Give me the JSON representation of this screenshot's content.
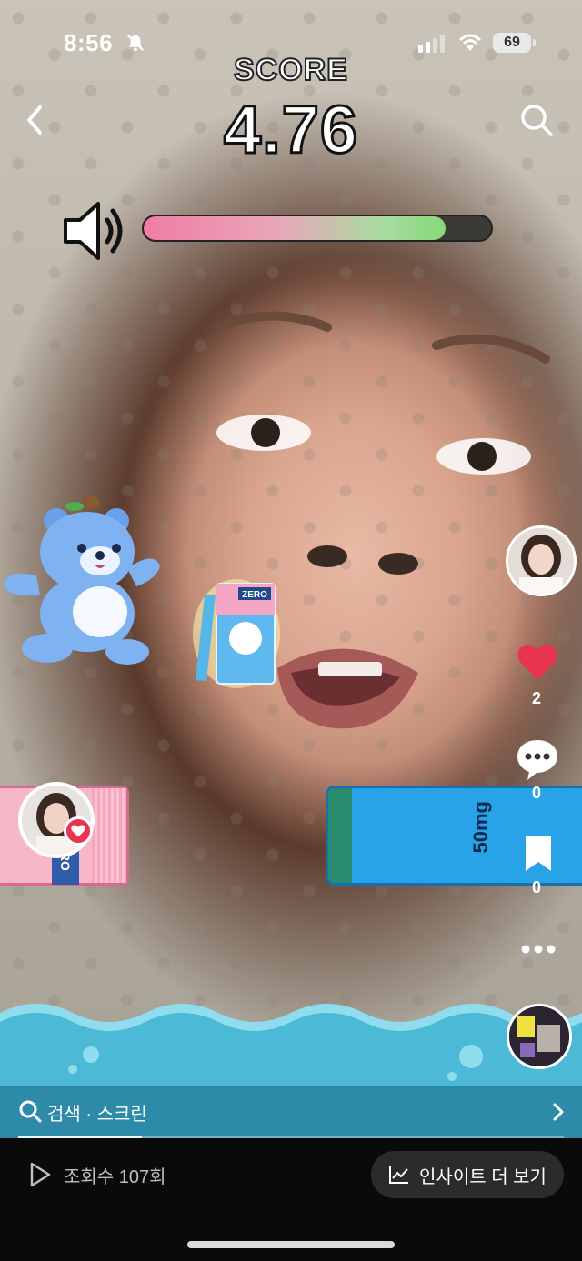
{
  "status_bar": {
    "time": "8:56",
    "battery": "69"
  },
  "game": {
    "score_label": "SCORE",
    "score_value": "4.76",
    "volume_level": 0.87
  },
  "packs": {
    "left_label": "ZERO",
    "right_label": "50mg"
  },
  "side_rail": {
    "like_count": "2",
    "comment_count": "0",
    "save_count": "0"
  },
  "search_bar": {
    "text": "검색 · 스크린"
  },
  "bottom": {
    "views": "조회수 107회",
    "insight_button": "인사이트 더 보기"
  },
  "colors": {
    "like": "#e8344d",
    "meter_start": "#f07ca6",
    "meter_end": "#86d97a",
    "search_bar": "#2d8ba9"
  }
}
